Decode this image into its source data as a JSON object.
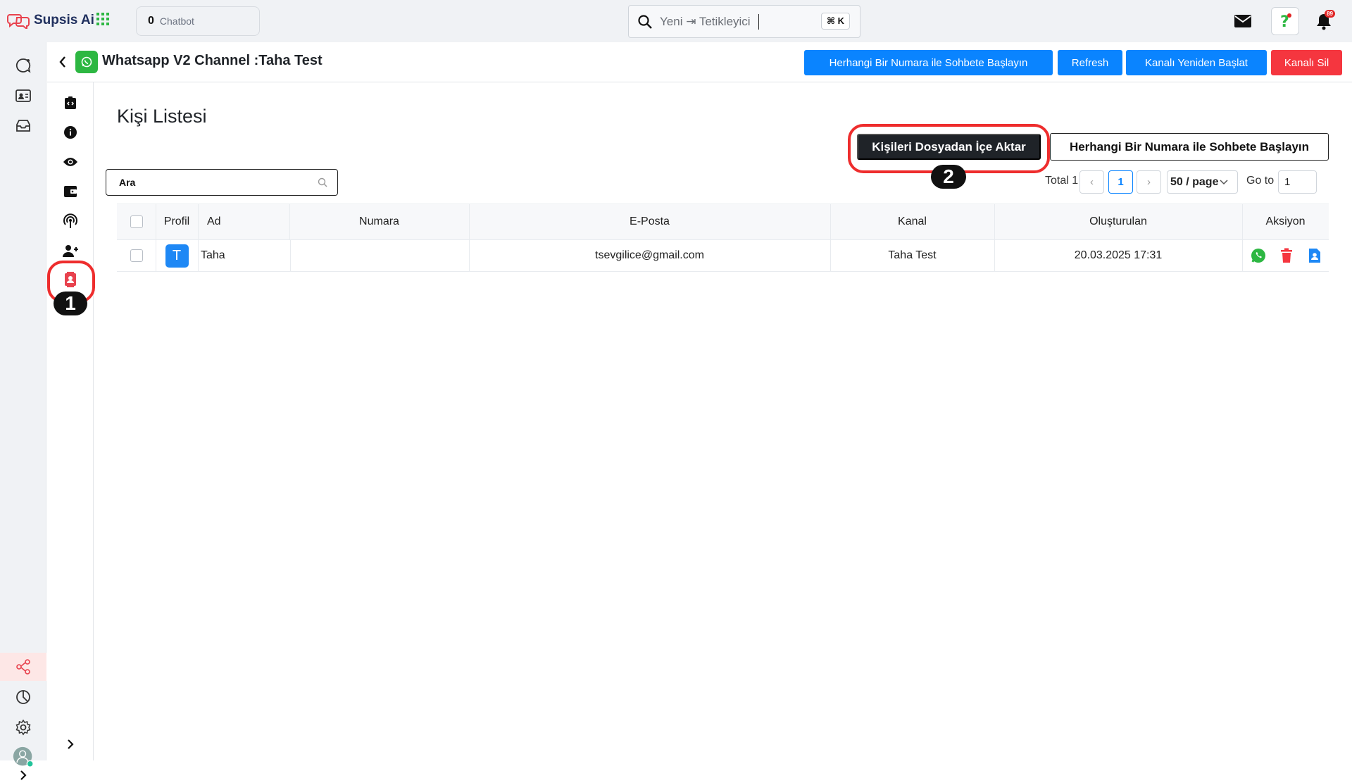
{
  "brand": {
    "name": "Supsis Ai"
  },
  "topbar": {
    "chatbot_count": "0",
    "chatbot_label": "Chatbot",
    "search_text": "Yeni ⇥ Tetikleyici",
    "shortcut": "⌘ K",
    "notifications_count": "89"
  },
  "header": {
    "title": "Whatsapp V2 Channel :Taha Test",
    "buttons": {
      "start_chat": "Herhangi Bir Numara ile Sohbete Başlayın",
      "refresh": "Refresh",
      "restart": "Kanalı Yeniden Başlat",
      "delete": "Kanalı Sil"
    }
  },
  "main": {
    "title": "Kişi Listesi",
    "search_value": "Ara",
    "import_button": "Kişileri Dosyadan İçe Aktar",
    "start_chat_button": "Herhangi Bir Numara ile Sohbete Başlayın",
    "callouts": {
      "one": "1",
      "two": "2"
    }
  },
  "pagination": {
    "total": "Total 1",
    "prev": "‹",
    "current": "1",
    "next": "›",
    "page_size": "50 / page",
    "goto_label": "Go to",
    "goto_value": "1"
  },
  "table": {
    "columns": [
      "Profil",
      "Ad",
      "Numara",
      "E-Posta",
      "Kanal",
      "Oluşturulan",
      "Aksiyon"
    ],
    "rows": [
      {
        "avatar": "T",
        "name": "Taha",
        "number": "",
        "email": "tsevgilice@gmail.com",
        "channel": "Taha Test",
        "created": "20.03.2025 17:31"
      }
    ]
  },
  "colors": {
    "primary": "#0a84ff",
    "danger": "#f5363f",
    "dark": "#1f2328",
    "highlight": "#ee2d2d",
    "whatsapp": "#2db742"
  }
}
